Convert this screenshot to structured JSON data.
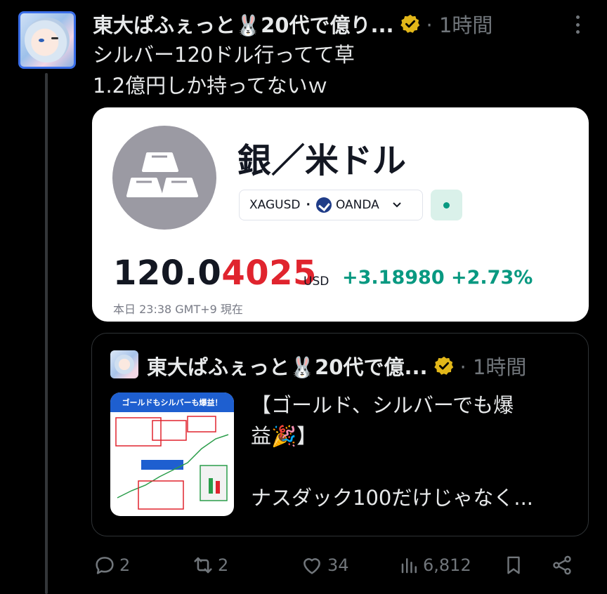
{
  "post": {
    "display_name": "東大ぱふぇっと🐰20代で億り...",
    "time": "· 1時間",
    "text_line1": "シルバー120ドル行ってて草",
    "text_line2": "1.2億円しか持ってないｗ"
  },
  "widget": {
    "symbol_title": "銀／米ドル",
    "ticker": "XAGUSD",
    "separator": "·",
    "exchange": "OANDA",
    "price_main": "120.0",
    "price_highlight": "4025",
    "currency": "USD",
    "change": "+3.18980 +2.73%",
    "timestamp": "本日 23:38 GMT+9 現在",
    "colors": {
      "up": "#089981",
      "highlight": "#e0242e"
    }
  },
  "quote": {
    "display_name": "東大ぱふぇっと🐰20代で億...",
    "time": "· 1時間",
    "thumb_banner": "ゴールドもシルバーも爆益！",
    "text_line1": "【ゴールド、シルバーでも爆",
    "text_line2": "益🎉】",
    "text_line3": "ナスダック100だけじゃなく..."
  },
  "actions": {
    "replies": "2",
    "reposts": "2",
    "likes": "34",
    "views": "6,812"
  },
  "icons": [
    "more-icon",
    "verified-badge-icon",
    "reply-icon",
    "repost-icon",
    "like-icon",
    "views-icon",
    "bookmark-icon",
    "share-icon",
    "silver-bars-icon",
    "chevron-down-icon"
  ]
}
